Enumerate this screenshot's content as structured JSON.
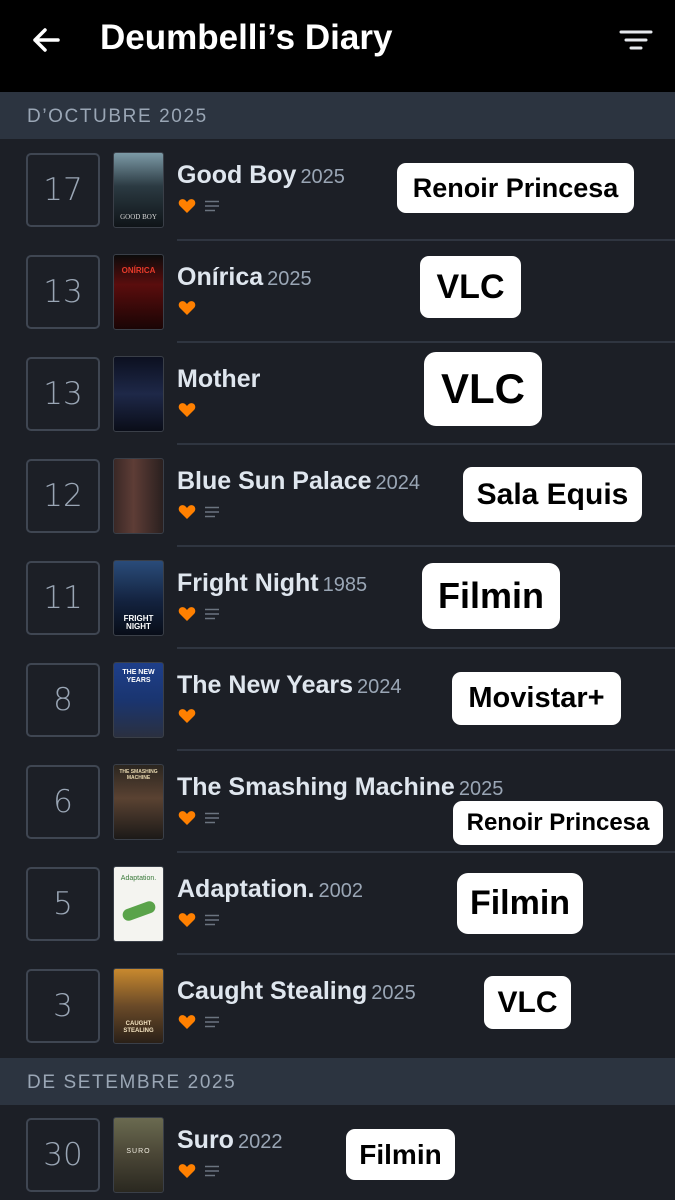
{
  "header": {
    "title": "Deumbelli’s Diary"
  },
  "sections": [
    {
      "label": "D’OCTUBRE 2025"
    },
    {
      "label": "DE SETEMBRE 2025"
    }
  ],
  "entries": [
    {
      "day": "17",
      "title": "Good Boy",
      "year": "2025",
      "poster_text": "GOOD BOY",
      "liked": true,
      "review": true,
      "tag": "Renoir Princesa"
    },
    {
      "day": "13",
      "title": "Onírica",
      "year": "2025",
      "poster_text": "ONÍRICA",
      "liked": true,
      "review": false,
      "tag": "VLC"
    },
    {
      "day": "13",
      "title": "Mother",
      "year": "",
      "poster_text": "",
      "liked": true,
      "review": false,
      "tag": "VLC"
    },
    {
      "day": "12",
      "title": "Blue Sun Palace",
      "year": "2024",
      "poster_text": "",
      "liked": true,
      "review": true,
      "tag": "Sala Equis"
    },
    {
      "day": "11",
      "title": "Fright Night",
      "year": "1985",
      "poster_text": "FRIGHT NIGHT",
      "liked": true,
      "review": true,
      "tag": "Filmin"
    },
    {
      "day": "8",
      "title": "The New Years",
      "year": "2024",
      "poster_text": "THE NEW YEARS",
      "liked": true,
      "review": false,
      "tag": "Movistar+"
    },
    {
      "day": "6",
      "title": "The Smashing Machine",
      "year": "2025",
      "poster_text": "THE SMASHING MACHINE",
      "liked": true,
      "review": true,
      "tag": "Renoir Princesa"
    },
    {
      "day": "5",
      "title": "Adaptation.",
      "year": "2002",
      "poster_text": "Adaptation.",
      "liked": true,
      "review": true,
      "tag": "Filmin"
    },
    {
      "day": "3",
      "title": "Caught Stealing",
      "year": "2025",
      "poster_text": "CAUGHT STEALING",
      "liked": true,
      "review": true,
      "tag": "VLC"
    },
    {
      "day": "30",
      "title": "Suro",
      "year": "2022",
      "poster_text": "SURO",
      "liked": true,
      "review": true,
      "tag": "Filmin"
    }
  ],
  "colors": {
    "background": "#1c1f26",
    "header_bg": "#000000",
    "section_bg": "#2c3440",
    "heart": "#ff8000",
    "muted": "#9aa6b5"
  },
  "icons": {
    "back": "arrow-left-icon",
    "filter": "filter-icon",
    "like": "heart-icon",
    "review": "review-lines-icon"
  }
}
